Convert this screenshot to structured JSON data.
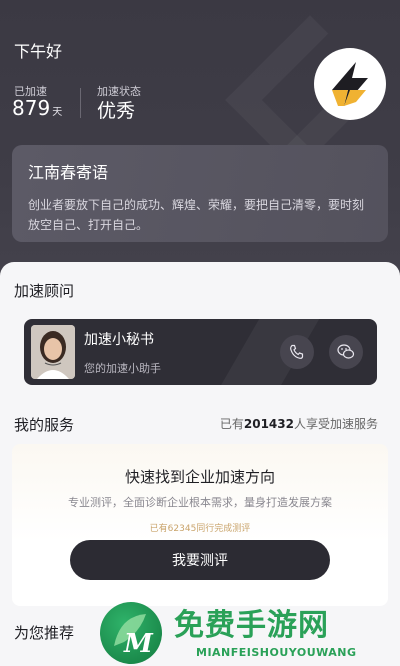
{
  "header": {
    "greeting": "下午好",
    "accelerated_label": "已加速",
    "accelerated_days": "879",
    "days_unit": "天",
    "status_label": "加速状态",
    "status_value": "优秀"
  },
  "quote": {
    "title": "江南春寄语",
    "text": "创业者要放下自己的成功、辉煌、荣耀，要把自己清零，要时刻放空自己、打开自己。"
  },
  "advisor_section": {
    "title": "加速顾问",
    "name": "加速小秘书",
    "subtitle": "您的加速小助手",
    "icons": [
      "phone-icon",
      "wechat-icon"
    ]
  },
  "services": {
    "title": "我的服务",
    "count_prefix": "已有",
    "count_value": "201432",
    "count_suffix": "人享受加速服务",
    "card_title": "快速找到企业加速方向",
    "card_desc": "专业测评，全面诊断企业根本需求，量身打造发展方案",
    "card_note": "已有62345同行完成测评",
    "cta_label": "我要测评"
  },
  "recommend": {
    "title": "为您推荐"
  },
  "watermark": {
    "text": "免费手游网",
    "sub": "MIANFEISHOUYOUWANG"
  },
  "colors": {
    "header_bg": "#3d3b45",
    "accent_gold": "#f0b232",
    "button_dark": "#2c2b33",
    "watermark_green": "#2aa158"
  }
}
